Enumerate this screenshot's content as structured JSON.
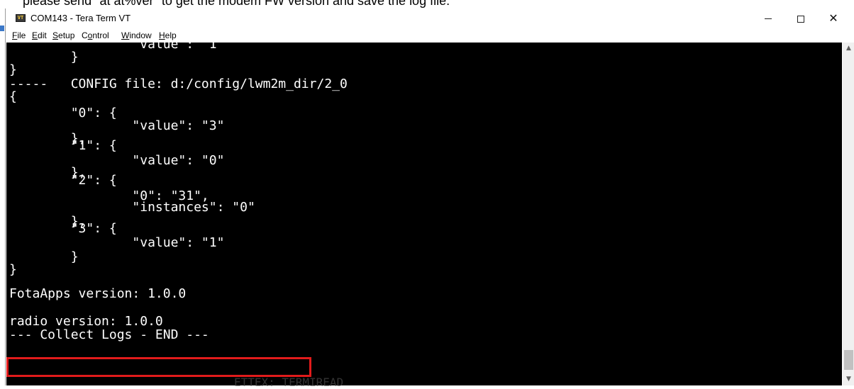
{
  "document": {
    "instruction_text": "please send \"at at%ver\" to get the modem FW version and save the log file."
  },
  "window": {
    "app_icon_text": "VT",
    "title": "COM143 - Tera Term VT",
    "minimize_label": "",
    "maximize_label": "",
    "close_label": "✕"
  },
  "menu": [
    {
      "pre": "",
      "key": "F",
      "post": "ile"
    },
    {
      "pre": "",
      "key": "E",
      "post": "dit"
    },
    {
      "pre": "",
      "key": "S",
      "post": "etup"
    },
    {
      "pre": "C",
      "key": "o",
      "post": "ntrol"
    },
    {
      "pre": "",
      "key": "W",
      "post": "indow"
    },
    {
      "pre": "",
      "key": "H",
      "post": "elp"
    }
  ],
  "terminal": {
    "lines": [
      "                \"value\": \"1\"",
      "        }",
      "}",
      "-----   CONFIG file: d:/config/lwm2m_dir/2_0",
      "{",
      "        \"0\": {",
      "                \"value\": \"3\"",
      "        },",
      "        \"1\": {",
      "                \"value\": \"0\"",
      "        },",
      "        \"2\": {",
      "                \"0\": \"31\",",
      "                \"instances\": \"0\"",
      "        },",
      "        \"3\": {",
      "                \"value\": \"1\"",
      "        }",
      "}",
      "FotaApps version: 1.0.0",
      "radio version: 1.0.0",
      "--- Collect Logs - END ---"
    ]
  },
  "scrollbar": {
    "up_arrow": "▲",
    "down_arrow": "▼"
  },
  "underbleed_text": "ETTEX: TERMIREAD"
}
